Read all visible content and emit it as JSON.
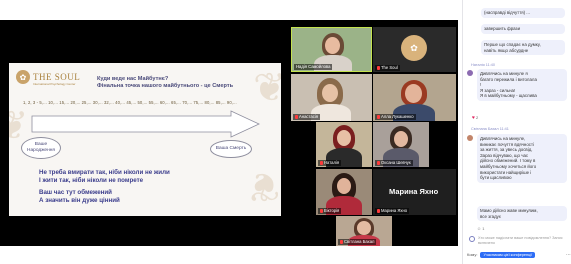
{
  "slide": {
    "logo": "THE SOUL",
    "logo_sub": "International Psychology Center",
    "title_line1": "Куди веде нас Майбутнє?",
    "title_line2": "Фінальна точка нашого майбутнього - це Смерть",
    "scale": "1, 2, 3 - 5,... 10,... 15,... 20,... 25,... 30,... 32,... 40,... 45,... 50,... 55,... 60,... 65,... 70,... 75,... 80,... 85,... 90,...",
    "birth_label": "Ваше Народження",
    "death_label": "Ваша Смерть",
    "body_line1": "Не треба вмирати так, ніби ніколи не жили",
    "body_line2": "І жити так, ніби ніколи не помрете",
    "body_line3": "Ваш час тут обмежений",
    "body_line4": "А значить він дуже цінний"
  },
  "participants": [
    {
      "name": "Надія Самойлова"
    },
    {
      "name": "The Soul"
    },
    {
      "name": "Анастасія"
    },
    {
      "name": "Алла Лукашенко"
    },
    {
      "name": "Наталія"
    },
    {
      "name": "Оксана Шевчук"
    },
    {
      "name": "Вікторія"
    },
    {
      "name": "Марина Яхно"
    },
    {
      "name": "Світлана Бахал"
    }
  ],
  "chat": {
    "messages": [
      {
        "lines": [
          "(насправді відчуття) ..."
        ]
      },
      {
        "lines": [
          "завершить фрази"
        ]
      },
      {
        "lines": [
          "Перше що спадає на думку,",
          "навіть якщо абсурдне"
        ]
      },
      {
        "author": "Наталія 11:40",
        "lines": [
          "Дивлячись на минуле я",
          "багато пережила і витолала",
          "!",
          "Я зараз - сильна!",
          "Я в майбутньому - щаслива"
        ]
      },
      {
        "author": "Світлана Бахал 11:41",
        "lines": [
          "Дивлячись на минуле,",
          "виникає почуття вдячності",
          "за життя, за увесь досвід.",
          "Зараз відчуваю, що час",
          "дійсно обмежений. І тому в",
          "майбутньому хочеться його",
          "використати найщиріше і",
          "бути щасливою"
        ]
      },
      {
        "lines": [
          "Мамо дійсно жаве минулим,",
          "все згадує"
        ]
      }
    ],
    "heart_count": "2",
    "reaction_count": "1",
    "input_placeholder": "Хто може надіслати ваше повідомлення? Запис включено",
    "to_label": "Кому:",
    "to_value": "Учасникам цієї конференції"
  },
  "colors": {
    "chat_bubble": "#eef0fb",
    "accent_blue": "#2d6df6",
    "speaker_outline": "#c4e34f",
    "slide_text": "#3b3d8c",
    "logo_gold": "#a9823f"
  }
}
